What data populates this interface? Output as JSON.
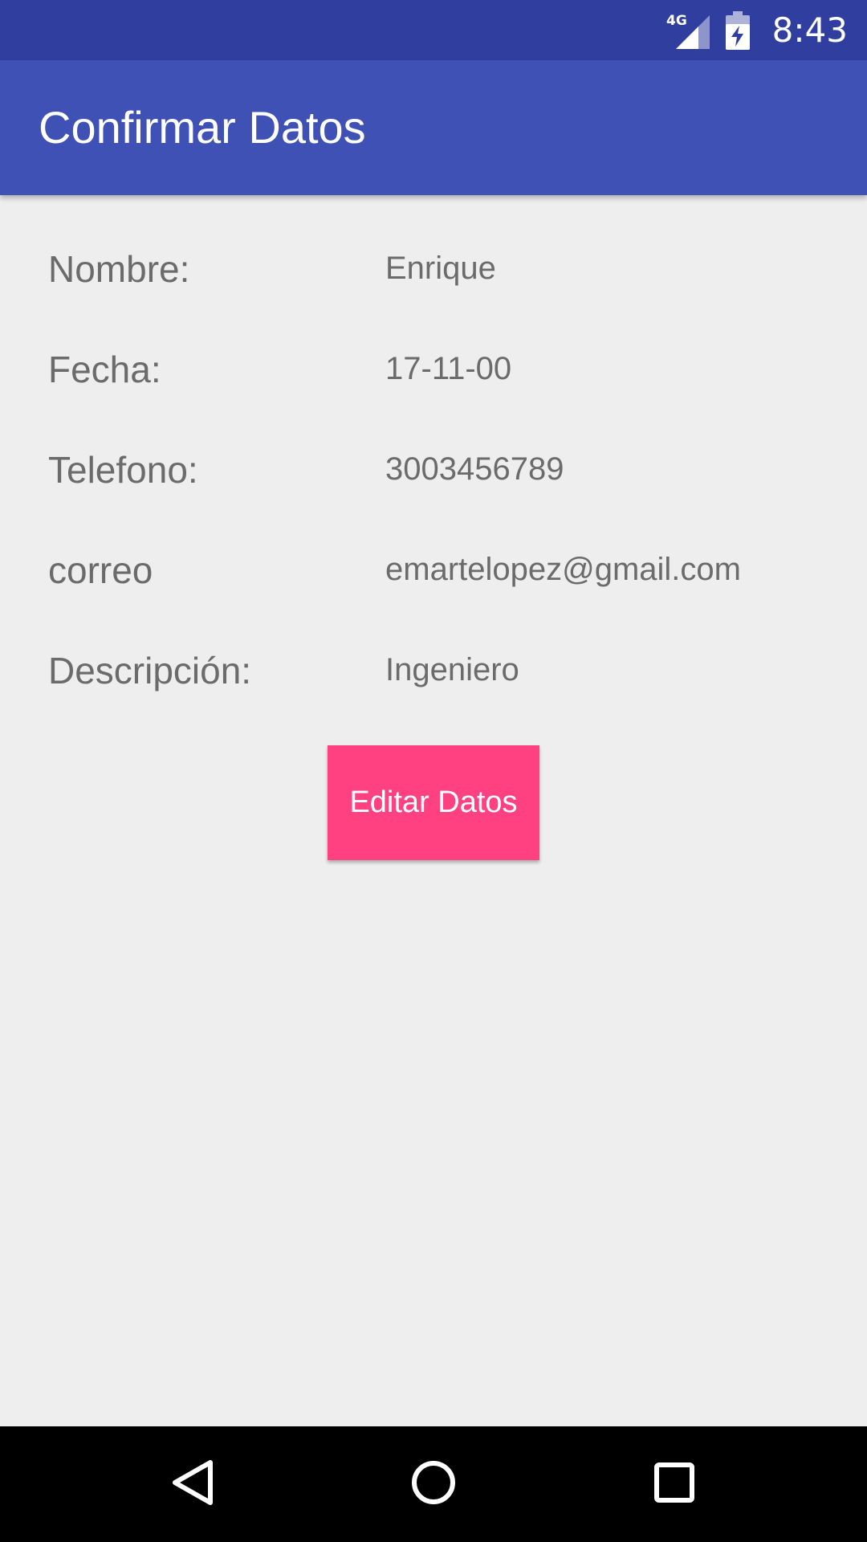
{
  "status_bar": {
    "network": "4G",
    "time": "8:43",
    "icons": [
      "signal-icon",
      "battery-charging-icon"
    ]
  },
  "app_bar": {
    "title": "Confirmar Datos"
  },
  "fields": [
    {
      "label": "Nombre:",
      "value": "Enrique"
    },
    {
      "label": "Fecha:",
      "value": "17-11-00"
    },
    {
      "label": "Telefono:",
      "value": "3003456789"
    },
    {
      "label": "correo",
      "value": "emartelopez@gmail.com"
    },
    {
      "label": "Descripción:",
      "value": "Ingeniero"
    }
  ],
  "actions": {
    "edit_label": "Editar Datos"
  },
  "nav_bar": {
    "icons": [
      "back-icon",
      "home-icon",
      "recents-icon"
    ]
  },
  "colors": {
    "status_bar": "#303f9f",
    "app_bar": "#3f51b5",
    "accent": "#ff4081",
    "background": "#eeeeee",
    "text": "#6b6b6b"
  }
}
